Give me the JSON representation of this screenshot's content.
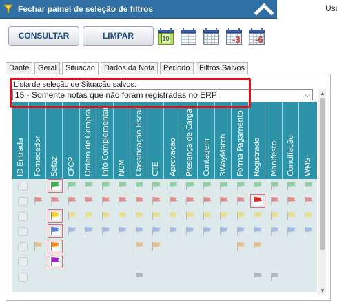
{
  "header": {
    "title": "Fechar painel de seleção de filtros",
    "user_label": "Usu",
    "funnel_icon": "funnel-icon",
    "collapse_icon": "chevron-up-icon"
  },
  "toolbar": {
    "consultar_label": "CONSULTAR",
    "limpar_label": "LIMPAR",
    "calendars": [
      {
        "name": "calendar-today-icon",
        "badge": "10"
      },
      {
        "name": "calendar-week-icon",
        "badge": ""
      },
      {
        "name": "calendar-month-icon",
        "badge": ""
      },
      {
        "name": "calendar-minus-3-icon",
        "badge": "-3"
      },
      {
        "name": "calendar-minus-6-icon",
        "badge": "-6"
      }
    ]
  },
  "tabs": [
    {
      "label": "Danfe",
      "active": false
    },
    {
      "label": "Geral",
      "active": false
    },
    {
      "label": "Situação",
      "active": true
    },
    {
      "label": "Dados da Nota",
      "active": false
    },
    {
      "label": "Período",
      "active": false
    },
    {
      "label": "Filtros Salvos",
      "active": false
    }
  ],
  "saved": {
    "label": "Lista de seleção de Situação salvos:",
    "selected": "15 - Somente notas que não foram registradas no ERP"
  },
  "columns": [
    "ID Entrada",
    "Fornecedor",
    "Sefaz",
    "CFOP",
    "Ordem de Compra",
    "Info Complementar",
    "NCM",
    "Classificação Fiscal",
    "CTE",
    "Aprovação",
    "Presença de Carga",
    "Contagem",
    "3WayMatch",
    "Forma Pagamento",
    "Registrado",
    "Manifesto",
    "Conciliação",
    "WMS"
  ],
  "colors": {
    "header_bar": "#2f6fa3",
    "grid_header": "#2c93a8",
    "grid_body": "#dde9ea",
    "highlight_border": "#d9141c",
    "flag_green": "#37b34a",
    "flag_red": "#e02020",
    "flag_yellow": "#f2d21b",
    "flag_blue": "#5b7fe0",
    "flag_orange": "#f08a1c",
    "flag_purple": "#a21fc7",
    "flag_gray": "#7f7f7f"
  },
  "rows": [
    {
      "icon": "status-ok-icon",
      "color": "flag_green",
      "flags": [
        2,
        3,
        4,
        5,
        6,
        7,
        8,
        9,
        10,
        11,
        12,
        13,
        14,
        15,
        16,
        17
      ],
      "selected": [
        2
      ]
    },
    {
      "icon": "status-download-icon",
      "color": "flag_red",
      "flags": [
        1,
        2,
        3,
        4,
        5,
        6,
        7,
        8,
        9,
        10,
        11,
        12,
        13,
        14,
        15,
        16,
        17
      ],
      "selected": [
        14
      ]
    },
    {
      "icon": "status-transfer-icon",
      "color": "flag_yellow",
      "flags": [
        2,
        3,
        4,
        5,
        6,
        7,
        8,
        9,
        10,
        11,
        12,
        13,
        14,
        15,
        16,
        17
      ],
      "selected": [
        2
      ]
    },
    {
      "icon": "status-mail-icon",
      "color": "flag_blue",
      "flags": [
        2,
        3,
        4,
        5,
        6,
        7,
        8,
        9,
        10,
        11,
        12,
        13,
        14,
        15,
        16,
        17
      ],
      "selected": [
        2
      ]
    },
    {
      "icon": "status-gear-icon",
      "color": "flag_orange",
      "flags": [
        1,
        2,
        7,
        8,
        13,
        14
      ],
      "selected": [
        2
      ]
    },
    {
      "icon": "status-document-icon",
      "color": "flag_purple",
      "flags": [
        2
      ],
      "selected": [
        2
      ]
    },
    {
      "icon": "status-none-icon",
      "color": "flag_gray",
      "flags": [
        7,
        14,
        15
      ],
      "selected": []
    }
  ]
}
